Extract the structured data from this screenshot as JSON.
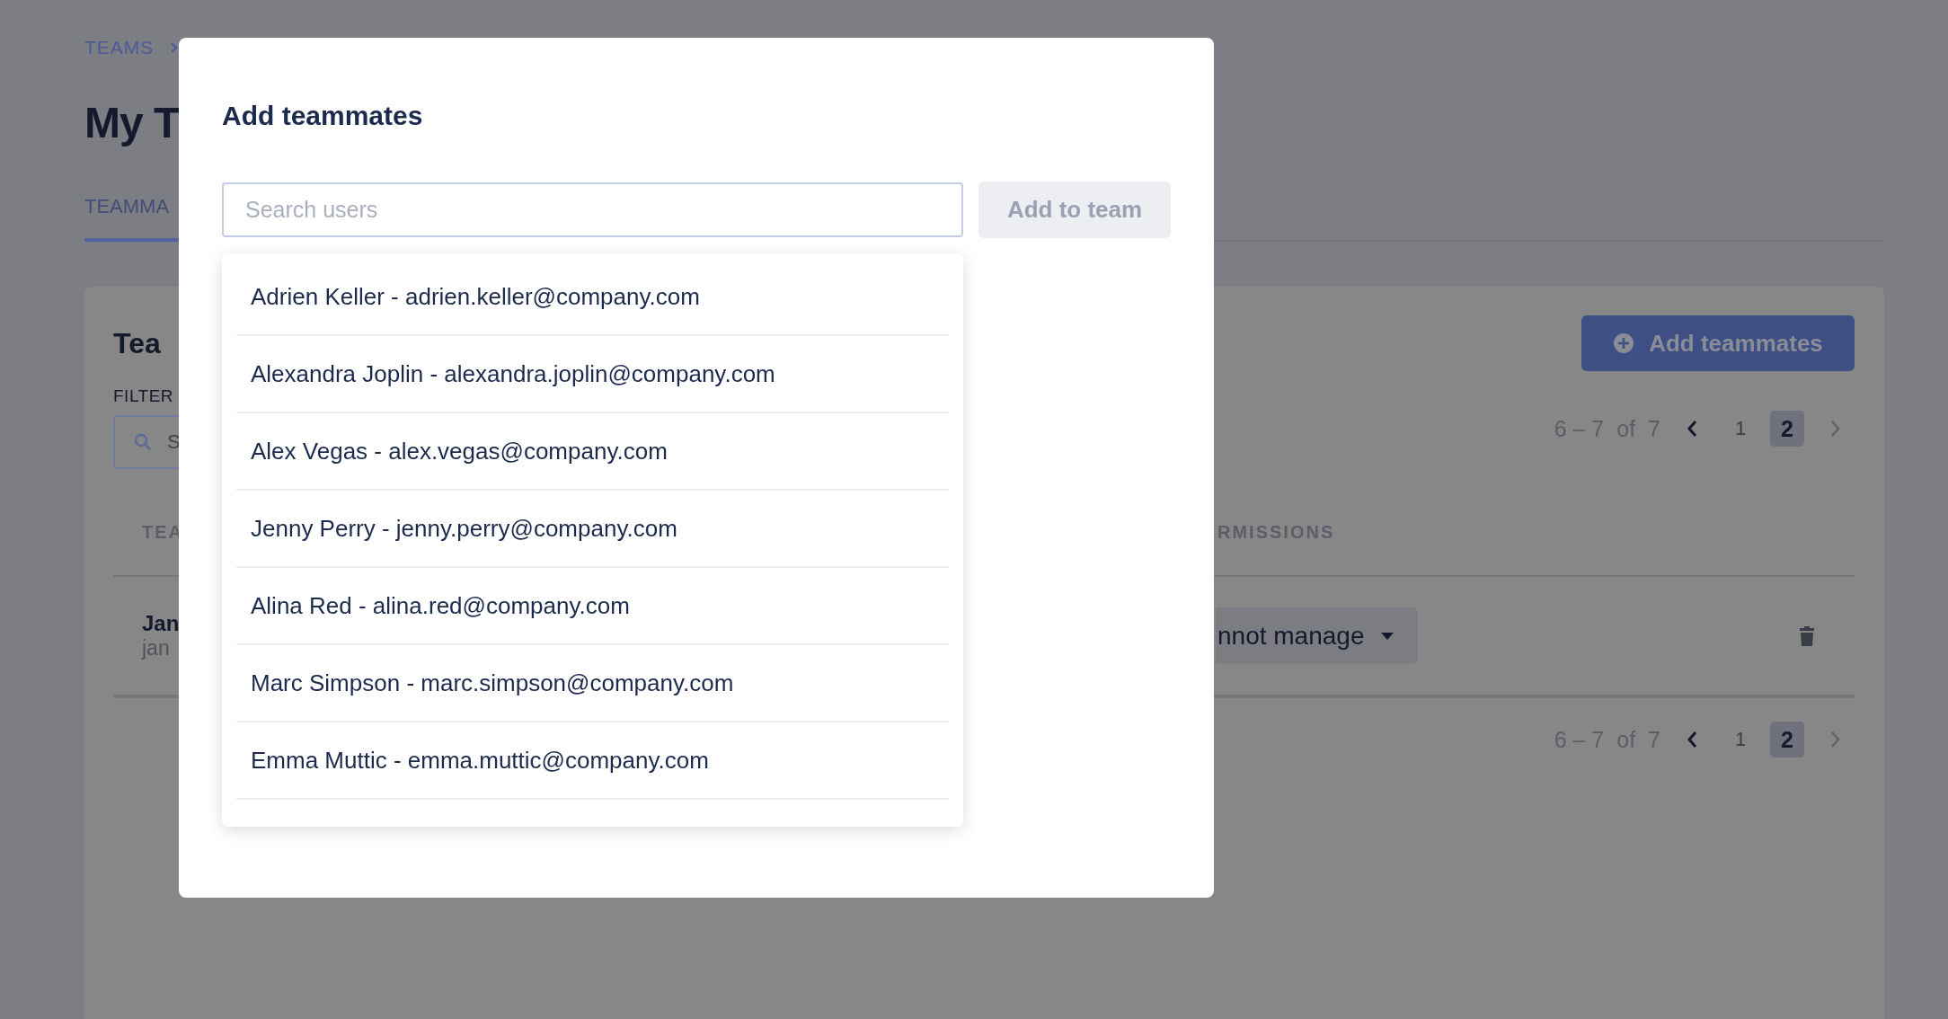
{
  "breadcrumb": {
    "items": [
      "TEAMS"
    ]
  },
  "page_title": "My T",
  "tabs": [
    {
      "label": "TEAMMA",
      "selected": true
    }
  ],
  "card": {
    "title": "Tea",
    "add_button": "Add teammates",
    "filter_label": "FILTER",
    "filter_search": {
      "placeholder": "S"
    },
    "pagination_top": {
      "range": "6 – 7",
      "of": "of",
      "total": "7",
      "prev_disabled": false,
      "next_disabled": true,
      "pages": [
        {
          "label": "1",
          "selected": false
        },
        {
          "label": "2",
          "selected": true
        }
      ]
    },
    "table": {
      "columns": [
        "TEA",
        "RMISSIONS"
      ],
      "rows": [
        {
          "name": "Jan",
          "email": "jan",
          "permission": "nnot manage"
        }
      ]
    },
    "pagination_bottom": {
      "range": "6 – 7",
      "of": "of",
      "total": "7",
      "prev_disabled": false,
      "next_disabled": true,
      "pages": [
        {
          "label": "1",
          "selected": false
        },
        {
          "label": "2",
          "selected": true
        }
      ]
    }
  },
  "modal": {
    "title": "Add teammates",
    "search": {
      "placeholder": "Search users"
    },
    "add_button": {
      "label": "Add to team",
      "disabled": true
    },
    "suggestions": [
      {
        "label": "Adrien Keller - adrien.keller@company.com"
      },
      {
        "label": "Alexandra Joplin - alexandra.joplin@company.com"
      },
      {
        "label": "Alex Vegas - alex.vegas@company.com"
      },
      {
        "label": "Jenny Perry - jenny.perry@company.com"
      },
      {
        "label": "Alina Red - alina.red@company.com"
      },
      {
        "label": "Marc Simpson - marc.simpson@company.com"
      },
      {
        "label": "Emma Muttic - emma.muttic@company.com"
      }
    ]
  }
}
